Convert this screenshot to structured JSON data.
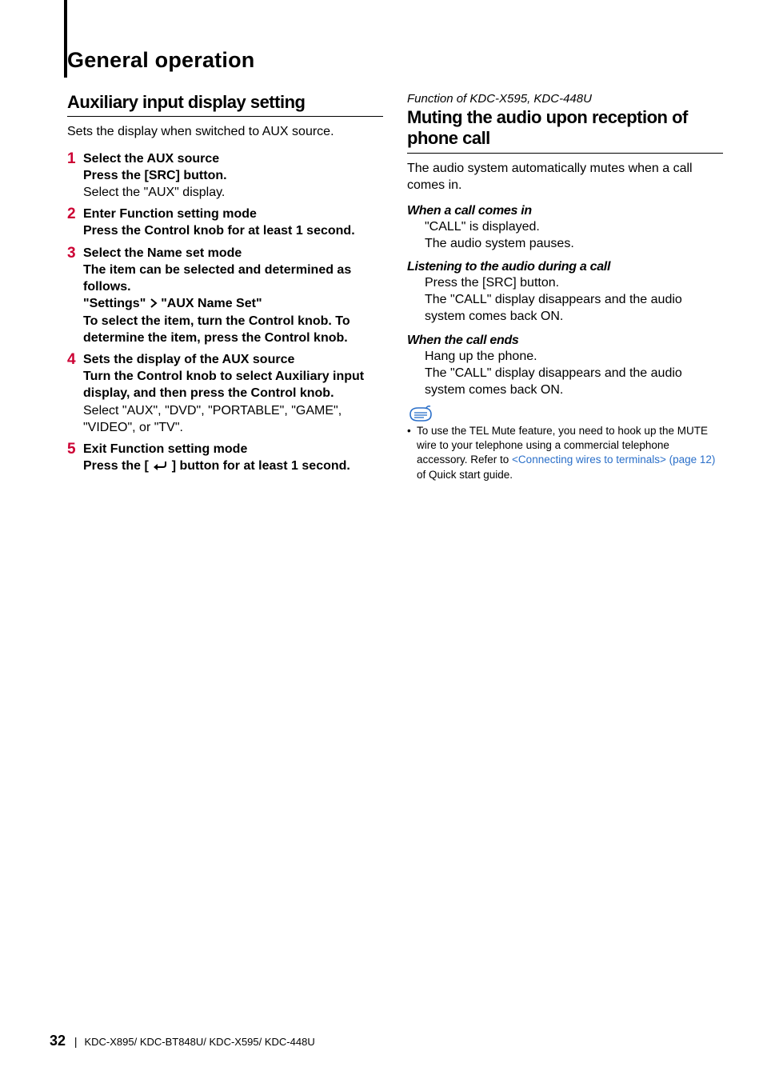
{
  "section_title": "General operation",
  "left": {
    "h2": "Auxiliary input display setting",
    "lead": "Sets the display when switched to AUX source.",
    "steps": [
      {
        "n": "1",
        "title": "Select the AUX source",
        "bold1": "Press the [SRC] button.",
        "plain1": "Select the \"AUX\" display."
      },
      {
        "n": "2",
        "title": "Enter Function setting mode",
        "bold1": "Press the Control knob for at least 1 second."
      },
      {
        "n": "3",
        "title": "Select the Name set mode",
        "bold1": "The item can be selected and determined as follows.",
        "bold2a": "\"Settings\"",
        "bold2b": "\"AUX Name Set\"",
        "bold3": "To select the item, turn the Control knob. To determine the item, press the Control knob."
      },
      {
        "n": "4",
        "title": "Sets the display of the AUX source",
        "bold1": "Turn the Control knob to select Auxiliary input display, and then press the Control knob.",
        "plain1": "Select \"AUX\", \"DVD\", \"PORTABLE\", \"GAME\", \"VIDEO\", or \"TV\"."
      },
      {
        "n": "5",
        "title": "Exit Function setting mode",
        "bold1a": "Press the [ ",
        "bold1b": " ] button for at least 1 second."
      }
    ]
  },
  "right": {
    "func_of": "Function of KDC-X595, KDC-448U",
    "h2": "Muting the audio upon reception of phone call",
    "lead": "The audio system automatically mutes when a call comes in.",
    "sub1": {
      "h": "When a call comes in",
      "l1": "\"CALL\" is displayed.",
      "l2": "The audio system pauses."
    },
    "sub2": {
      "h": "Listening to the audio during a call",
      "bold": "Press the [SRC] button.",
      "l1": "The \"CALL\" display disappears and the audio system comes back ON."
    },
    "sub3": {
      "h": "When the call ends",
      "bold": "Hang up the phone.",
      "l1": "The \"CALL\" display disappears and the audio system comes back ON."
    },
    "note": {
      "pre": "To use the TEL Mute feature, you need to hook up the MUTE wire to your telephone using a commercial telephone accessory. Refer to ",
      "link": "<Connecting wires to terminals> (page 12)",
      "post": " of Quick start guide."
    }
  },
  "footer": {
    "page": "32",
    "models": "KDC-X895/ KDC-BT848U/ KDC-X595/ KDC-448U"
  }
}
